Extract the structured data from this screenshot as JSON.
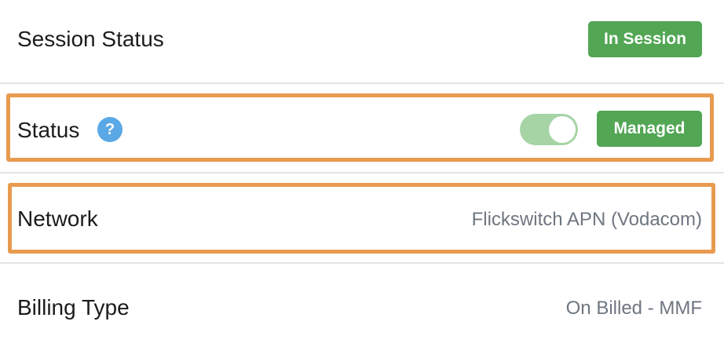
{
  "rows": {
    "session_status": {
      "label": "Session Status",
      "badge": "In Session"
    },
    "status": {
      "label": "Status",
      "help_icon_glyph": "?",
      "toggle_state": "on",
      "badge": "Managed"
    },
    "network": {
      "label": "Network",
      "value": "Flickswitch APN (Vodacom)"
    },
    "billing_type": {
      "label": "Billing Type",
      "value": "On Billed - MMF"
    }
  },
  "colors": {
    "badge_green": "#52a654",
    "toggle_on": "#a6d4a5",
    "help_blue": "#5aa8e6",
    "highlight_orange": "#e89a4f",
    "divider": "#e2e4e6",
    "value_gray": "#6e7680"
  },
  "icons": {
    "help": "question-circle-icon"
  }
}
